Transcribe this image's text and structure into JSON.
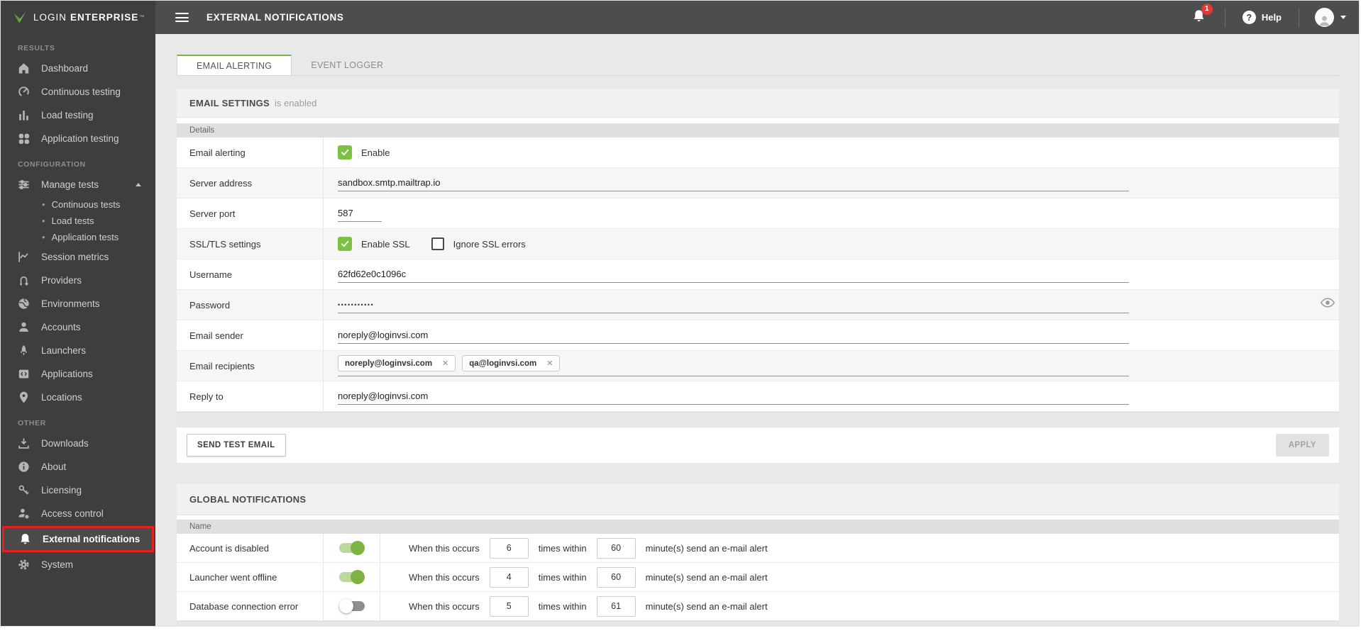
{
  "brand": {
    "word1": "LOGIN",
    "word2": "ENTERPRISE",
    "trademark": "™"
  },
  "topbar": {
    "title": "EXTERNAL NOTIFICATIONS",
    "notification_count": "1",
    "help_label": "Help"
  },
  "icons": {
    "question": "?",
    "close": "✕",
    "bullet": "•"
  },
  "sidebar": {
    "sections": [
      {
        "label": "RESULTS",
        "items": [
          "Dashboard",
          "Continuous testing",
          "Load testing",
          "Application testing"
        ]
      },
      {
        "label": "CONFIGURATION",
        "items": [
          "Manage tests",
          "Continuous tests",
          "Load tests",
          "Application tests",
          "Session metrics",
          "Providers",
          "Environments",
          "Accounts",
          "Launchers",
          "Applications",
          "Locations"
        ]
      },
      {
        "label": "OTHER",
        "items": [
          "Downloads",
          "About",
          "Licensing",
          "Access control",
          "External notifications",
          "System"
        ]
      }
    ],
    "active_item": "External notifications"
  },
  "tabs": [
    {
      "label": "EMAIL ALERTING",
      "active": true
    },
    {
      "label": "EVENT LOGGER",
      "active": false
    }
  ],
  "email_settings": {
    "title": "EMAIL SETTINGS",
    "subtitle": "is enabled",
    "details_header": "Details",
    "rows": {
      "email_alerting": {
        "label": "Email alerting",
        "checkbox_label": "Enable",
        "checked": true
      },
      "server_address": {
        "label": "Server address",
        "value": "sandbox.smtp.mailtrap.io"
      },
      "server_port": {
        "label": "Server port",
        "value": "587"
      },
      "ssl": {
        "label": "SSL/TLS settings",
        "enable_label": "Enable SSL",
        "enable_checked": true,
        "ignore_label": "Ignore SSL errors",
        "ignore_checked": false
      },
      "username": {
        "label": "Username",
        "value": "62fd62e0c1096c"
      },
      "password": {
        "label": "Password",
        "value": "•••••••••••"
      },
      "email_sender": {
        "label": "Email sender",
        "value": "noreply@loginvsi.com"
      },
      "email_recipients": {
        "label": "Email recipients",
        "chips": [
          "noreply@loginvsi.com",
          "qa@loginvsi.com"
        ]
      },
      "reply_to": {
        "label": "Reply to",
        "value": "noreply@loginvsi.com"
      }
    },
    "send_test_button": "SEND TEST EMAIL",
    "apply_button": "APPLY"
  },
  "global_notifications": {
    "title": "GLOBAL NOTIFICATIONS",
    "name_header": "Name",
    "condition_text": {
      "when": "When this occurs",
      "times": "times within",
      "minutes": "minute(s) send an e-mail alert"
    },
    "rows": [
      {
        "label": "Account is disabled",
        "enabled": true,
        "occurs": "6",
        "within": "60"
      },
      {
        "label": "Launcher went offline",
        "enabled": true,
        "occurs": "4",
        "within": "60"
      },
      {
        "label": "Database connection error",
        "enabled": false,
        "occurs": "5",
        "within": "61"
      }
    ]
  },
  "colors": {
    "accent_green": "#7cb342",
    "badge_red": "#e53935",
    "highlight_red": "#e8201d",
    "sidebar_bg": "#3e3e3e",
    "topbar_bg": "#4d4d4d"
  }
}
